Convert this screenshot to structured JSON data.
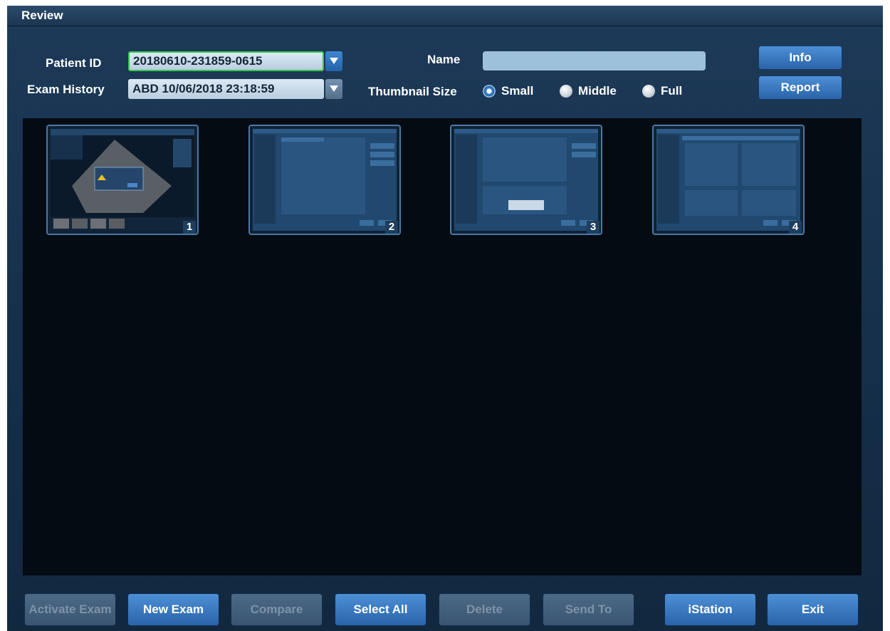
{
  "title": "Review",
  "patient_id": {
    "label": "Patient ID",
    "value": "20180610-231859-0615"
  },
  "exam_history": {
    "label": "Exam History",
    "value": "ABD 10/06/2018 23:18:59"
  },
  "name": {
    "label": "Name",
    "value": ""
  },
  "thumbnail_size": {
    "label": "Thumbnail Size",
    "options": [
      "Small",
      "Middle",
      "Full"
    ],
    "selected": "Small"
  },
  "side_buttons": {
    "info": "Info",
    "report": "Report"
  },
  "thumbnails": [
    {
      "number": "1"
    },
    {
      "number": "2"
    },
    {
      "number": "3"
    },
    {
      "number": "4"
    }
  ],
  "bottom_buttons": [
    {
      "label": "Activate Exam",
      "enabled": false
    },
    {
      "label": "New Exam",
      "enabled": true
    },
    {
      "label": "Compare",
      "enabled": false
    },
    {
      "label": "Select All",
      "enabled": true
    },
    {
      "label": "Delete",
      "enabled": false
    },
    {
      "label": "Send To",
      "enabled": false
    },
    {
      "label": "iStation",
      "enabled": true
    },
    {
      "label": "Exit",
      "enabled": true
    }
  ],
  "colors": {
    "accent": "#3d8ad9",
    "active_field_border": "#34c94b",
    "background": "#152e49",
    "thumbnail_panel": "#050b12"
  }
}
